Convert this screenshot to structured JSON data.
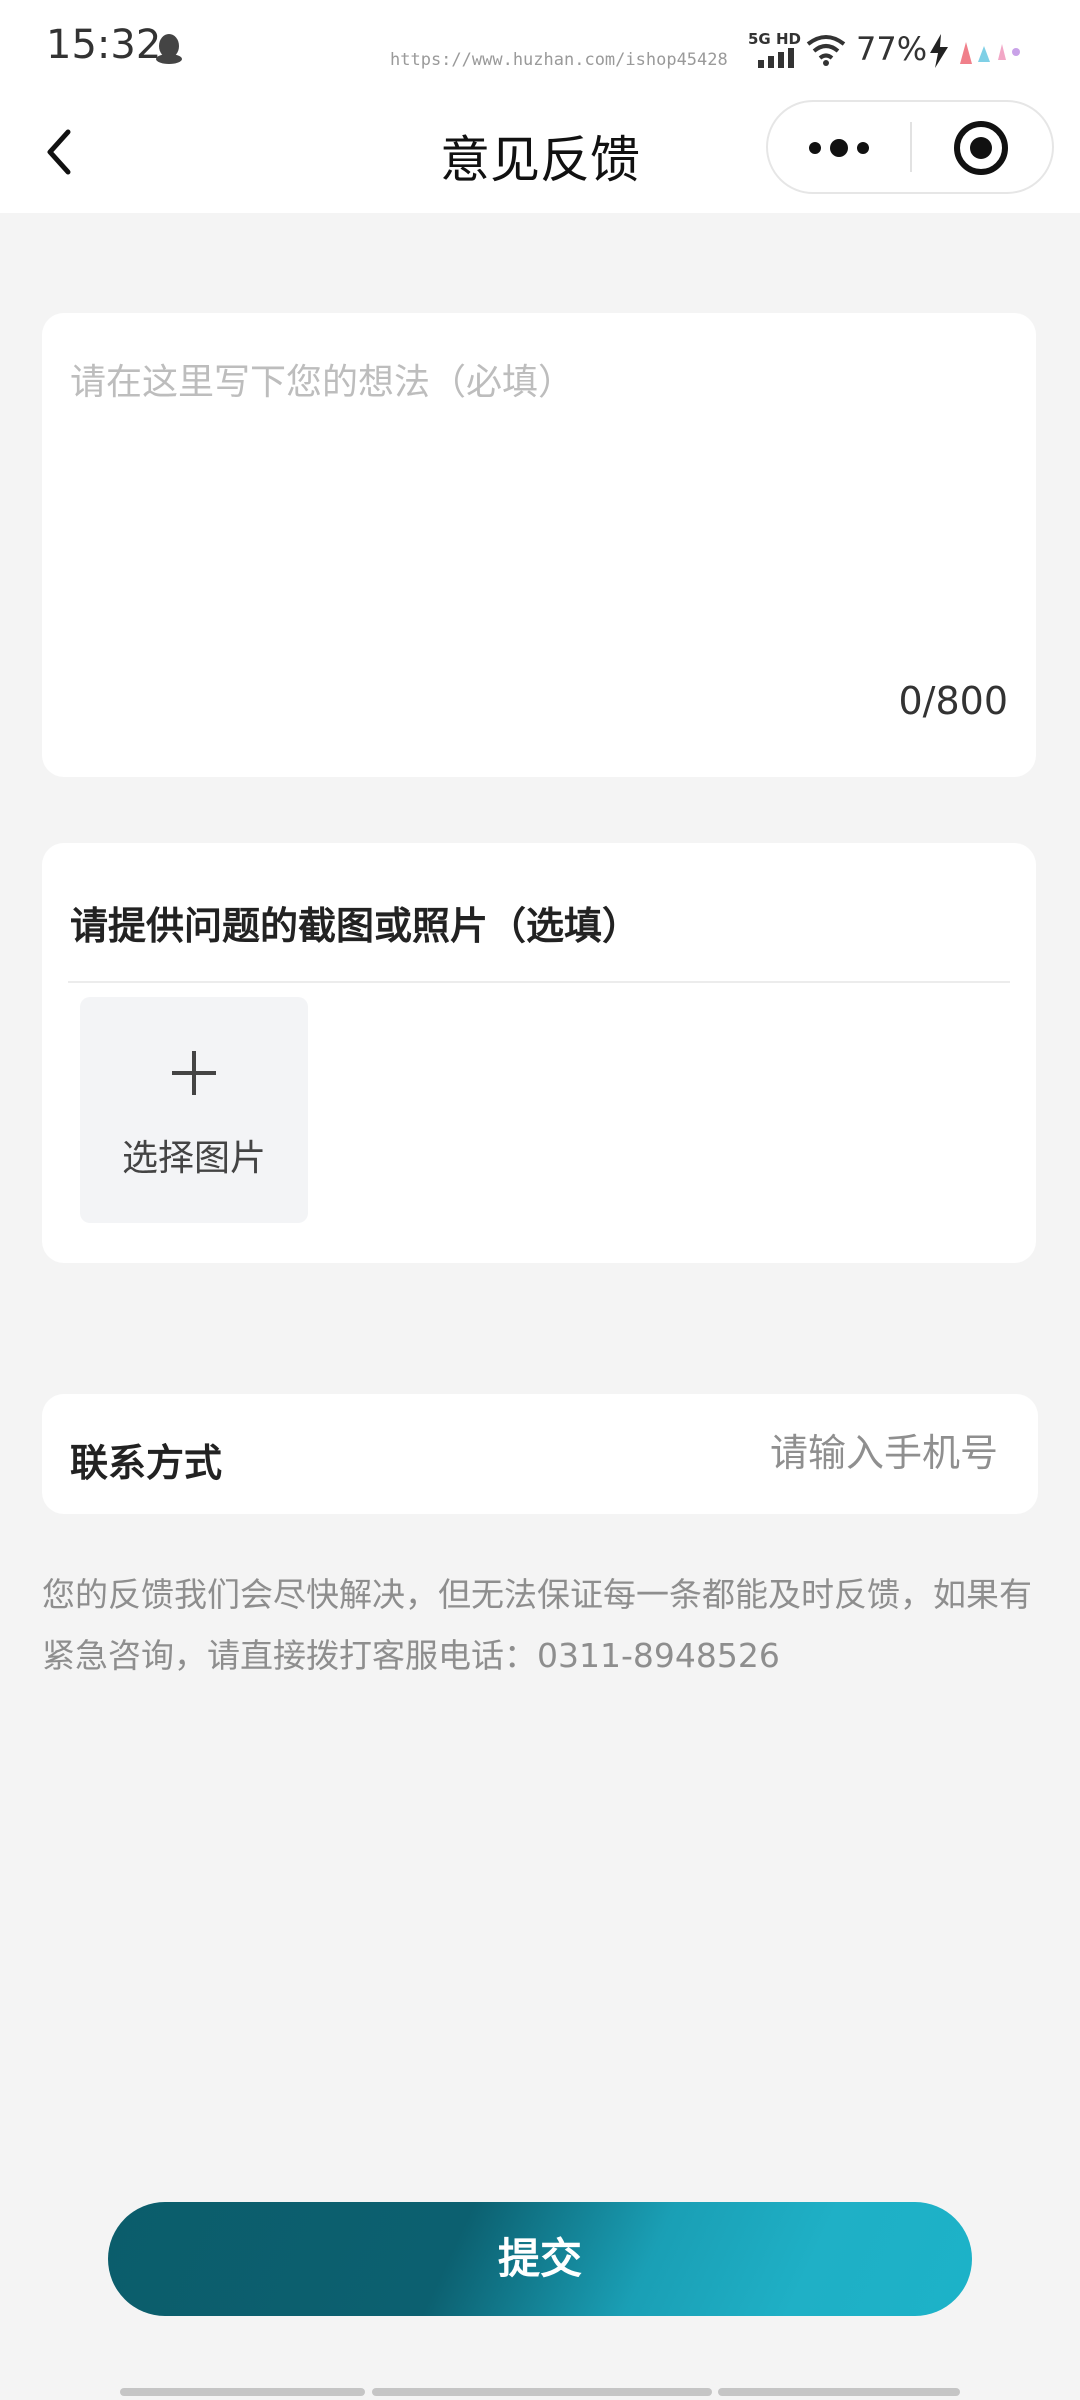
{
  "status_bar": {
    "time": "15:32",
    "watermark": "https://www.huzhan.com/ishop45428",
    "network": "5G HD",
    "battery": "77%"
  },
  "nav": {
    "title": "意见反馈"
  },
  "feedback": {
    "placeholder": "请在这里写下您的想法（必填）",
    "value": "",
    "counter": "0/800"
  },
  "upload": {
    "title": "请提供问题的截图或照片（选填）",
    "tile_label": "选择图片"
  },
  "contact": {
    "label": "联系方式",
    "placeholder": "请输入手机号",
    "value": ""
  },
  "notice": "您的反馈我们会尽快解决，但无法保证每一条都能及时反馈，如果有紧急咨询，请直接拨打客服电话：0311-8948526",
  "submit_label": "提交",
  "colors": {
    "page_bg": "#f4f4f4",
    "card_bg": "#ffffff",
    "accent_dark": "#0b5d6b",
    "accent_light": "#1fb0c6"
  }
}
